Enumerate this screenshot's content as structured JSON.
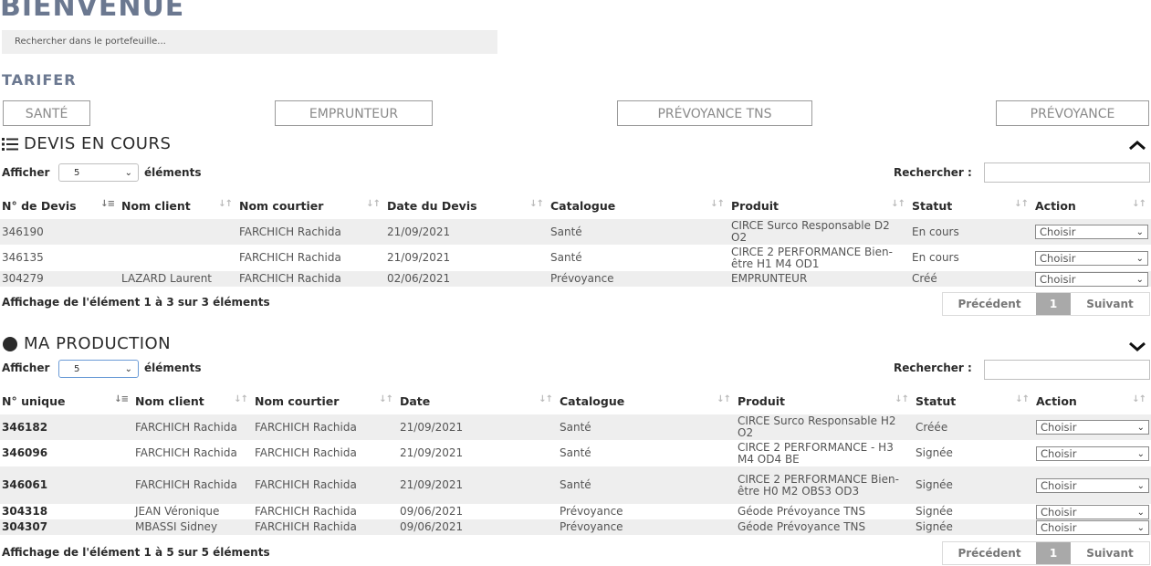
{
  "page": {
    "title": "BIENVENUE",
    "search_placeholder": "Rechercher dans le portefeuille..."
  },
  "tarifer": {
    "title": "TARIFER",
    "buttons": [
      "SANTÉ",
      "EMPRUNTEUR",
      "PRÉVOYANCE TNS",
      "PRÉVOYANCE"
    ]
  },
  "devis": {
    "title": "DEVIS EN COURS",
    "collapse_icon": "chevron-up-icon",
    "show_label": "Afficher",
    "show_value": "5",
    "elements_label": "éléments",
    "search_label": "Rechercher :",
    "columns": [
      "N° de Devis",
      "Nom client",
      "Nom courtier",
      "Date du Devis",
      "Catalogue",
      "Produit",
      "Statut",
      "Action"
    ],
    "rows": [
      {
        "num": "346190",
        "client": "",
        "courtier": "FARCHICH Rachida",
        "date": "21/09/2021",
        "catalogue": "Santé",
        "produit": "CIRCE Surco Responsable D2 O2",
        "statut": "En cours",
        "action": "Choisir"
      },
      {
        "num": "346135",
        "client": "",
        "courtier": "FARCHICH Rachida",
        "date": "21/09/2021",
        "catalogue": "Santé",
        "produit": "CIRCE 2 PERFORMANCE Bien-être H1 M4 OD1",
        "statut": "En cours",
        "action": "Choisir"
      },
      {
        "num": "304279",
        "client": "LAZARD Laurent",
        "courtier": "FARCHICH Rachida",
        "date": "02/06/2021",
        "catalogue": "Prévoyance",
        "produit": "EMPRUNTEUR",
        "statut": "Créé",
        "action": "Choisir"
      }
    ],
    "info": "Affichage de l'élément 1 à 3 sur 3 éléments",
    "pager": {
      "prev": "Précédent",
      "current": "1",
      "next": "Suivant"
    }
  },
  "production": {
    "title": "MA PRODUCTION",
    "collapse_icon": "chevron-down-icon",
    "show_label": "Afficher",
    "show_value": "5",
    "elements_label": "éléments",
    "search_label": "Rechercher :",
    "columns": [
      "N° unique",
      "Nom client",
      "Nom courtier",
      "Date",
      "Catalogue",
      "Produit",
      "Statut",
      "Action"
    ],
    "rows": [
      {
        "num": "346182",
        "client": "FARCHICH Rachida",
        "courtier": "FARCHICH Rachida",
        "date": "21/09/2021",
        "catalogue": "Santé",
        "produit": "CIRCE Surco Responsable H2 O2",
        "statut": "Créée",
        "action": "Choisir"
      },
      {
        "num": "346096",
        "client": "FARCHICH Rachida",
        "courtier": "FARCHICH Rachida",
        "date": "21/09/2021",
        "catalogue": "Santé",
        "produit": "CIRCE 2 PERFORMANCE - H3 M4 OD4 BE",
        "statut": "Signée",
        "action": "Choisir"
      },
      {
        "num": "346061",
        "client": "FARCHICH Rachida",
        "courtier": "FARCHICH Rachida",
        "date": "21/09/2021",
        "catalogue": "Santé",
        "produit": "CIRCE 2 PERFORMANCE Bien-être H0 M2 OBS3 OD3",
        "statut": "Signée",
        "action": "Choisir"
      },
      {
        "num": "304318",
        "client": "JEAN Véronique",
        "courtier": "FARCHICH Rachida",
        "date": "09/06/2021",
        "catalogue": "Prévoyance",
        "produit": "Géode Prévoyance TNS",
        "statut": "Signée",
        "action": "Choisir"
      },
      {
        "num": "304307",
        "client": "MBASSI Sidney",
        "courtier": "FARCHICH Rachida",
        "date": "09/06/2021",
        "catalogue": "Prévoyance",
        "produit": "Géode Prévoyance TNS",
        "statut": "Signée",
        "action": "Choisir"
      }
    ],
    "info": "Affichage de l'élément 1 à 5 sur 5 éléments",
    "pager": {
      "prev": "Précédent",
      "current": "1",
      "next": "Suivant"
    }
  }
}
